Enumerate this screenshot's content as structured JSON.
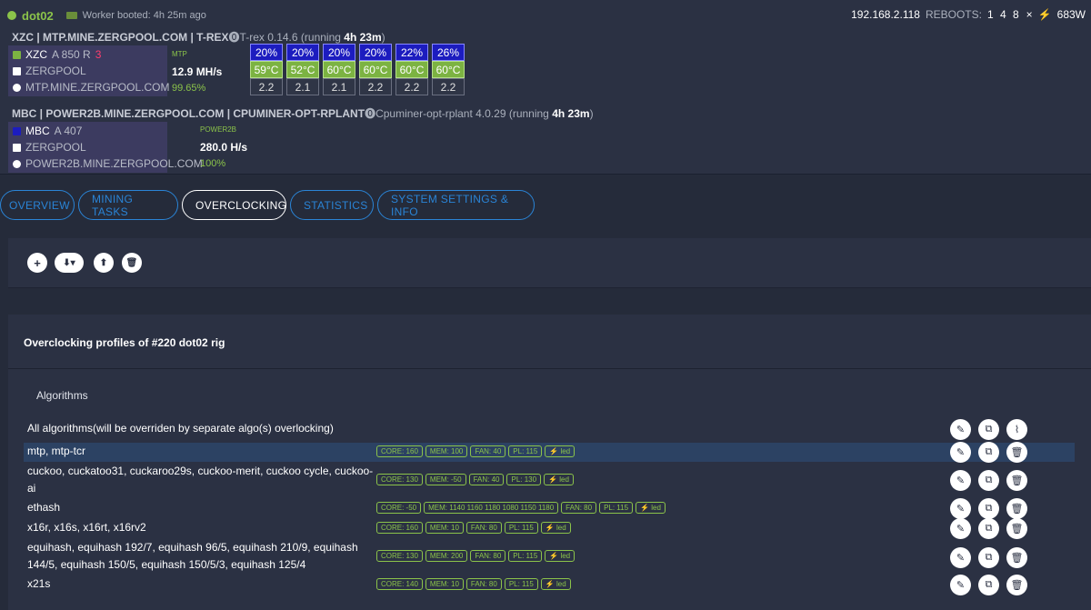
{
  "rig": {
    "name": "dot02",
    "boot_text": "Worker booted: 4h 25m ago",
    "ip": "192.168.2.118",
    "reboots_label": "REBOOTS:",
    "reboots_value": "1 4 8",
    "times": "×",
    "power": "683W"
  },
  "miner1": {
    "header_prefix": "XZC | MTP.MINE.ZERGPOOL.COM | T-REX",
    "miner_name": "T-rex 0.14.6 (running",
    "running": "4h 23m",
    "close": ")",
    "coin": "XZC",
    "coin_info": "A 850 R",
    "rejected": "3",
    "pool": "ZERGPOOL",
    "url": "MTP.MINE.ZERGPOOL.COM",
    "algo": "MTP",
    "speed": "12.9 MH/s",
    "accept_pct": "99.65%"
  },
  "miner2": {
    "header_prefix": "MBC | POWER2B.MINE.ZERGPOOL.COM | CPUMINER-OPT-RPLANT",
    "miner_name": "Cpuminer-opt-rplant 4.0.29 (running",
    "running": "4h 23m",
    "close": ")",
    "coin": "MBC",
    "coin_info": "A 407",
    "pool": "ZERGPOOL",
    "url": "POWER2B.MINE.ZERGPOOL.COM",
    "algo": "POWER2B",
    "speed": "280.0 H/s",
    "accept_pct": "100%"
  },
  "gpus": [
    {
      "fan": "20%",
      "temp": "59°C",
      "oc": "2.2"
    },
    {
      "fan": "20%",
      "temp": "52°C",
      "oc": "2.1"
    },
    {
      "fan": "20%",
      "temp": "60°C",
      "oc": "2.1"
    },
    {
      "fan": "20%",
      "temp": "60°C",
      "oc": "2.2"
    },
    {
      "fan": "22%",
      "temp": "60°C",
      "oc": "2.2"
    },
    {
      "fan": "26%",
      "temp": "60°C",
      "oc": "2.2"
    }
  ],
  "tabs": [
    "OVERVIEW",
    "MINING TASKS",
    "OVERCLOCKING",
    "STATISTICS",
    "SYSTEM SETTINGS & INFO"
  ],
  "toolbar": {
    "add": "+",
    "download": "⬇▾",
    "upload": "⬆",
    "delete": "🗑"
  },
  "profiles_title": "Overclocking profiles of #220 dot02 rig",
  "algorithms_title": "Algorithms",
  "rows": [
    {
      "name": "All algorithms(will be overriden by separate algo(s) overlocking)",
      "badges": []
    },
    {
      "name": "mtp, mtp-tcr",
      "badges": [
        "CORE: 160",
        "MEM: 100",
        "FAN: 40",
        "PL: 115",
        "⚡ led"
      ]
    },
    {
      "name": "cuckoo, cuckatoo31, cuckaroo29s, cuckoo-merit, cuckoo cycle, cuckoo-ai",
      "badges": [
        "CORE: 130",
        "MEM: -50",
        "FAN: 40",
        "PL: 130",
        "⚡ led"
      ]
    },
    {
      "name": "ethash",
      "badges": [
        "CORE: -50",
        "MEM: 1140 1160 1180 1080 1150 1180",
        "FAN: 80",
        "PL: 115",
        "⚡ led"
      ]
    },
    {
      "name": "x16r, x16s, x16rt, x16rv2",
      "badges": [
        "CORE: 160",
        "MEM: 10",
        "FAN: 80",
        "PL: 115",
        "⚡ led"
      ]
    },
    {
      "name": "equihash, equihash 192/7, equihash 96/5, equihash 210/9, equihash 144/5, equihash 150/5, equihash 150/5/3, equihash 125/4",
      "badges": [
        "CORE: 130",
        "MEM: 200",
        "FAN: 80",
        "PL: 115",
        "⚡ led"
      ]
    },
    {
      "name": "x21s",
      "badges": [
        "CORE: 140",
        "MEM: 10",
        "FAN: 80",
        "PL: 115",
        "⚡ led"
      ]
    }
  ],
  "icons": {
    "edit": "pencil-icon",
    "copy": "copy-icon",
    "clear": "broom-icon",
    "delete": "trash-icon"
  }
}
